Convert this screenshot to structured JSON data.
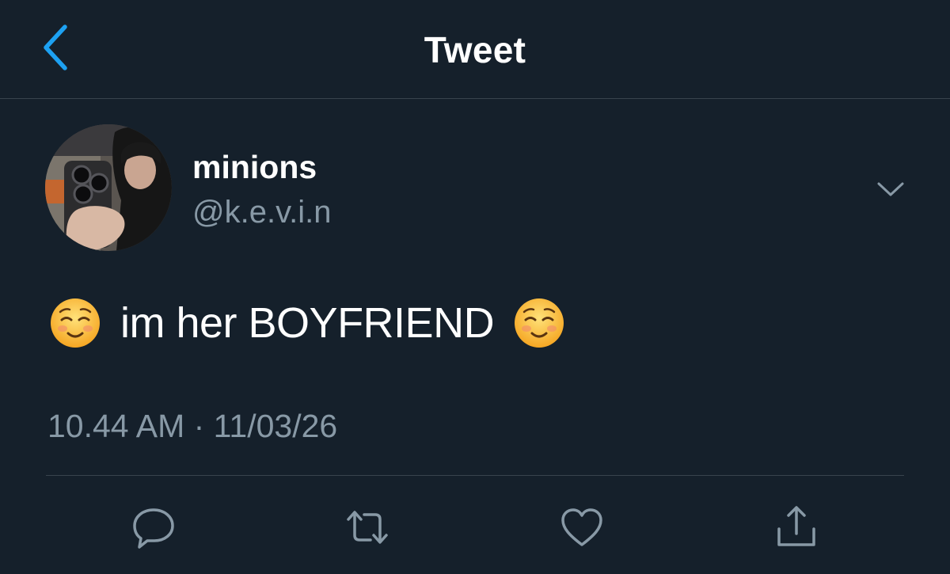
{
  "header": {
    "title": "Tweet",
    "back_icon": "chevron-left-icon"
  },
  "tweet": {
    "author": {
      "display_name": "minions",
      "handle": "@k.e.v.i.n",
      "avatar": "avatar-photo"
    },
    "text": "im her BOYFRIEND",
    "emoji": "smiling-face-icon",
    "timestamp": "10.44 AM · 11/03/26",
    "more_icon": "chevron-down-icon"
  },
  "actions": [
    {
      "name": "reply",
      "icon": "reply-icon"
    },
    {
      "name": "retweet",
      "icon": "retweet-icon"
    },
    {
      "name": "like",
      "icon": "heart-icon"
    },
    {
      "name": "share",
      "icon": "share-icon"
    }
  ],
  "colors": {
    "background": "#15202b",
    "accent": "#1da1f2",
    "secondary_text": "#8899a6",
    "divider": "#38444d"
  }
}
